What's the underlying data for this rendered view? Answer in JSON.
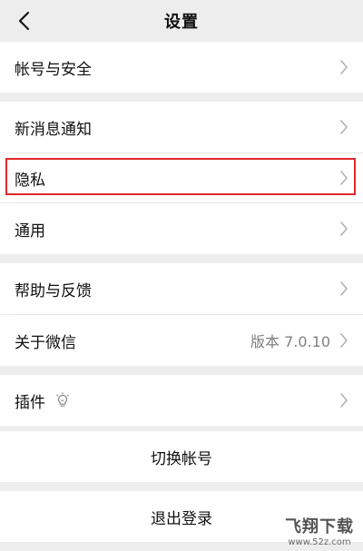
{
  "header": {
    "title": "设置"
  },
  "groups": {
    "account": {
      "label": "帐号与安全"
    },
    "notifications": {
      "label": "新消息通知"
    },
    "privacy": {
      "label": "隐私"
    },
    "general": {
      "label": "通用"
    },
    "help": {
      "label": "帮助与反馈"
    },
    "about": {
      "label": "关于微信",
      "version": "版本 7.0.10"
    },
    "plugins": {
      "label": "插件"
    }
  },
  "actions": {
    "switch_account": "切换帐号",
    "logout": "退出登录"
  },
  "watermark": {
    "title": "飞翔下载",
    "url": "www.52z.com"
  },
  "colors": {
    "background": "#ededed",
    "highlight": "#e0282a"
  }
}
